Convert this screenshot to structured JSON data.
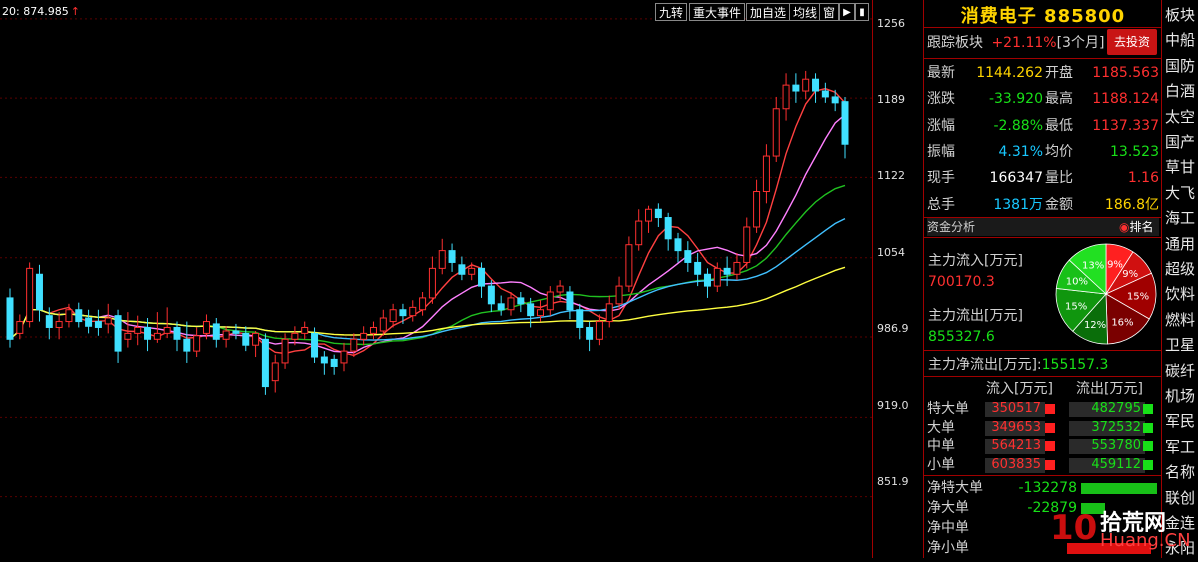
{
  "chart": {
    "ma_label": "20: 874.985",
    "ma_arrow": "↑",
    "toolbar": [
      "九转",
      "重大事件",
      "加自选",
      "均线",
      "窗"
    ],
    "y_ticks": [
      "1256",
      "1189",
      "1122",
      "1054",
      "986.9",
      "919.0",
      "851.9"
    ]
  },
  "chart_data": {
    "type": "candlestick",
    "ylim": [
      800,
      1272
    ],
    "candles": [
      {
        "o": 1020,
        "c": 985,
        "h": 1028,
        "l": 978
      },
      {
        "o": 990,
        "c": 1000,
        "h": 1006,
        "l": 985
      },
      {
        "o": 1000,
        "c": 1045,
        "h": 1050,
        "l": 995
      },
      {
        "o": 1040,
        "c": 1010,
        "h": 1048,
        "l": 1000
      },
      {
        "o": 1005,
        "c": 995,
        "h": 1012,
        "l": 985
      },
      {
        "o": 995,
        "c": 1000,
        "h": 1008,
        "l": 985
      },
      {
        "o": 1000,
        "c": 1010,
        "h": 1015,
        "l": 995
      },
      {
        "o": 1010,
        "c": 1000,
        "h": 1016,
        "l": 995
      },
      {
        "o": 1003,
        "c": 996,
        "h": 1010,
        "l": 990
      },
      {
        "o": 1000,
        "c": 995,
        "h": 1010,
        "l": 988
      },
      {
        "o": 998,
        "c": 1003,
        "h": 1015,
        "l": 990
      },
      {
        "o": 1005,
        "c": 975,
        "h": 1010,
        "l": 965
      },
      {
        "o": 985,
        "c": 990,
        "h": 1008,
        "l": 978
      },
      {
        "o": 990,
        "c": 995,
        "h": 1005,
        "l": 980
      },
      {
        "o": 995,
        "c": 985,
        "h": 1003,
        "l": 975
      },
      {
        "o": 985,
        "c": 990,
        "h": 1008,
        "l": 982
      },
      {
        "o": 990,
        "c": 995,
        "h": 1012,
        "l": 986
      },
      {
        "o": 995,
        "c": 985,
        "h": 1000,
        "l": 975
      },
      {
        "o": 985,
        "c": 975,
        "h": 1000,
        "l": 965
      },
      {
        "o": 975,
        "c": 988,
        "h": 995,
        "l": 970
      },
      {
        "o": 990,
        "c": 1000,
        "h": 1006,
        "l": 985
      },
      {
        "o": 998,
        "c": 985,
        "h": 1003,
        "l": 978
      },
      {
        "o": 985,
        "c": 992,
        "h": 996,
        "l": 978
      },
      {
        "o": 992,
        "c": 990,
        "h": 998,
        "l": 985
      },
      {
        "o": 990,
        "c": 980,
        "h": 996,
        "l": 975
      },
      {
        "o": 980,
        "c": 990,
        "h": 992,
        "l": 970
      },
      {
        "o": 985,
        "c": 945,
        "h": 990,
        "l": 938
      },
      {
        "o": 950,
        "c": 965,
        "h": 972,
        "l": 940
      },
      {
        "o": 965,
        "c": 985,
        "h": 990,
        "l": 960
      },
      {
        "o": 985,
        "c": 990,
        "h": 996,
        "l": 980
      },
      {
        "o": 990,
        "c": 995,
        "h": 1000,
        "l": 985
      },
      {
        "o": 990,
        "c": 970,
        "h": 995,
        "l": 965
      },
      {
        "o": 970,
        "c": 965,
        "h": 975,
        "l": 955
      },
      {
        "o": 968,
        "c": 962,
        "h": 972,
        "l": 955
      },
      {
        "o": 965,
        "c": 975,
        "h": 982,
        "l": 958
      },
      {
        "o": 975,
        "c": 985,
        "h": 990,
        "l": 970
      },
      {
        "o": 985,
        "c": 990,
        "h": 996,
        "l": 980
      },
      {
        "o": 990,
        "c": 995,
        "h": 1000,
        "l": 985
      },
      {
        "o": 992,
        "c": 1003,
        "h": 1010,
        "l": 988
      },
      {
        "o": 1000,
        "c": 1010,
        "h": 1015,
        "l": 995
      },
      {
        "o": 1010,
        "c": 1005,
        "h": 1015,
        "l": 998
      },
      {
        "o": 1005,
        "c": 1012,
        "h": 1018,
        "l": 1000
      },
      {
        "o": 1010,
        "c": 1020,
        "h": 1025,
        "l": 1005
      },
      {
        "o": 1020,
        "c": 1045,
        "h": 1055,
        "l": 1015
      },
      {
        "o": 1045,
        "c": 1060,
        "h": 1070,
        "l": 1040
      },
      {
        "o": 1060,
        "c": 1050,
        "h": 1066,
        "l": 1042
      },
      {
        "o": 1048,
        "c": 1040,
        "h": 1055,
        "l": 1035
      },
      {
        "o": 1040,
        "c": 1045,
        "h": 1050,
        "l": 1035
      },
      {
        "o": 1045,
        "c": 1030,
        "h": 1050,
        "l": 1020
      },
      {
        "o": 1030,
        "c": 1015,
        "h": 1035,
        "l": 1008
      },
      {
        "o": 1015,
        "c": 1010,
        "h": 1022,
        "l": 1005
      },
      {
        "o": 1010,
        "c": 1020,
        "h": 1025,
        "l": 1005
      },
      {
        "o": 1020,
        "c": 1015,
        "h": 1025,
        "l": 1008
      },
      {
        "o": 1015,
        "c": 1005,
        "h": 1020,
        "l": 995
      },
      {
        "o": 1005,
        "c": 1010,
        "h": 1018,
        "l": 1000
      },
      {
        "o": 1010,
        "c": 1025,
        "h": 1030,
        "l": 1005
      },
      {
        "o": 1025,
        "c": 1030,
        "h": 1035,
        "l": 1018
      },
      {
        "o": 1025,
        "c": 1010,
        "h": 1030,
        "l": 1002
      },
      {
        "o": 1010,
        "c": 995,
        "h": 1015,
        "l": 985
      },
      {
        "o": 995,
        "c": 985,
        "h": 1000,
        "l": 975
      },
      {
        "o": 985,
        "c": 1000,
        "h": 1006,
        "l": 980
      },
      {
        "o": 1000,
        "c": 1015,
        "h": 1022,
        "l": 995
      },
      {
        "o": 1015,
        "c": 1030,
        "h": 1038,
        "l": 1010
      },
      {
        "o": 1030,
        "c": 1065,
        "h": 1072,
        "l": 1025
      },
      {
        "o": 1065,
        "c": 1085,
        "h": 1095,
        "l": 1060
      },
      {
        "o": 1085,
        "c": 1095,
        "h": 1098,
        "l": 1075
      },
      {
        "o": 1095,
        "c": 1088,
        "h": 1100,
        "l": 1080
      },
      {
        "o": 1088,
        "c": 1070,
        "h": 1092,
        "l": 1060
      },
      {
        "o": 1070,
        "c": 1060,
        "h": 1075,
        "l": 1050
      },
      {
        "o": 1060,
        "c": 1050,
        "h": 1068,
        "l": 1042
      },
      {
        "o": 1050,
        "c": 1040,
        "h": 1058,
        "l": 1030
      },
      {
        "o": 1040,
        "c": 1030,
        "h": 1045,
        "l": 1020
      },
      {
        "o": 1030,
        "c": 1045,
        "h": 1050,
        "l": 1025
      },
      {
        "o": 1045,
        "c": 1040,
        "h": 1055,
        "l": 1030
      },
      {
        "o": 1040,
        "c": 1050,
        "h": 1058,
        "l": 1035
      },
      {
        "o": 1050,
        "c": 1080,
        "h": 1088,
        "l": 1045
      },
      {
        "o": 1080,
        "c": 1110,
        "h": 1120,
        "l": 1075
      },
      {
        "o": 1110,
        "c": 1140,
        "h": 1150,
        "l": 1100
      },
      {
        "o": 1140,
        "c": 1180,
        "h": 1190,
        "l": 1135
      },
      {
        "o": 1180,
        "c": 1200,
        "h": 1210,
        "l": 1170
      },
      {
        "o": 1200,
        "c": 1195,
        "h": 1210,
        "l": 1185
      },
      {
        "o": 1195,
        "c": 1205,
        "h": 1212,
        "l": 1188
      },
      {
        "o": 1205,
        "c": 1195,
        "h": 1210,
        "l": 1185
      },
      {
        "o": 1195,
        "c": 1190,
        "h": 1202,
        "l": 1185
      },
      {
        "o": 1190,
        "c": 1185,
        "h": 1196,
        "l": 1178
      },
      {
        "o": 1186,
        "c": 1150,
        "h": 1190,
        "l": 1138
      }
    ]
  },
  "panel": {
    "title": "消费电子 885800",
    "track_label": "跟踪板块",
    "track_value": "+21.11%",
    "track_period": "[3个月]",
    "invest_button": "去投资",
    "quote_rows": [
      {
        "l1": "最新",
        "v1": "1144.262",
        "l2": "开盘",
        "v2": "1185.563"
      },
      {
        "l1": "涨跌",
        "v1": "-33.920",
        "l2": "最高",
        "v2": "1188.124"
      },
      {
        "l1": "涨幅",
        "v1": "-2.88%",
        "l2": "最低",
        "v2": "1137.337"
      },
      {
        "l1": "振幅",
        "v1": "4.31%",
        "l2": "均价",
        "v2": "13.523"
      },
      {
        "l1": "现手",
        "v1": "166347",
        "l2": "量比",
        "v2": "1.16"
      },
      {
        "l1": "总手",
        "v1": "1381万",
        "l2": "金额",
        "v2": "186.8亿"
      }
    ],
    "fund_label": "资金分析",
    "rank_label": "排名",
    "inflow_label": "主力流入[万元]",
    "inflow_value": "700170.3",
    "outflow_label": "主力流出[万元]",
    "outflow_value": "855327.6",
    "net_outflow_label": "主力净流出[万元]:",
    "net_outflow_value": "155157.3",
    "pie": [
      {
        "label": "9%",
        "color": "#ff2020"
      },
      {
        "label": "9%",
        "color": "#d01010"
      },
      {
        "label": "15%",
        "color": "#a00000"
      },
      {
        "label": "16%",
        "color": "#7a0000"
      },
      {
        "label": "12%",
        "color": "#0a6e0a"
      },
      {
        "label": "15%",
        "color": "#10960e"
      },
      {
        "label": "10%",
        "color": "#18c018"
      },
      {
        "label": "13%",
        "color": "#22e022"
      }
    ],
    "flow_header_in": "流入[万元]",
    "flow_header_out": "流出[万元]",
    "flow_rows": [
      {
        "label": "特大单",
        "in": "350517",
        "out": "482795"
      },
      {
        "label": "大单",
        "in": "349653",
        "out": "372532"
      },
      {
        "label": "中单",
        "in": "564213",
        "out": "553780"
      },
      {
        "label": "小单",
        "in": "603835",
        "out": "459112"
      }
    ],
    "net_rows": [
      {
        "label": "净特大单",
        "value": "-132278"
      },
      {
        "label": "净大单",
        "value": "-22879"
      },
      {
        "label": "净中单",
        "value": ""
      },
      {
        "label": "净小单",
        "value": ""
      }
    ]
  },
  "list": {
    "items": [
      "板块",
      "中船",
      "国防",
      "白酒",
      "太空",
      "国产",
      "草甘",
      "大飞",
      "海工",
      "通用",
      "超级",
      "饮料",
      "燃料",
      "卫星",
      "碳纤",
      "机场",
      "军民",
      "军工",
      "名称",
      "联创",
      "金连",
      "永阳"
    ]
  },
  "watermark": {
    "num": "10",
    "text": "拾荒网",
    "url": "Huang.CN"
  }
}
